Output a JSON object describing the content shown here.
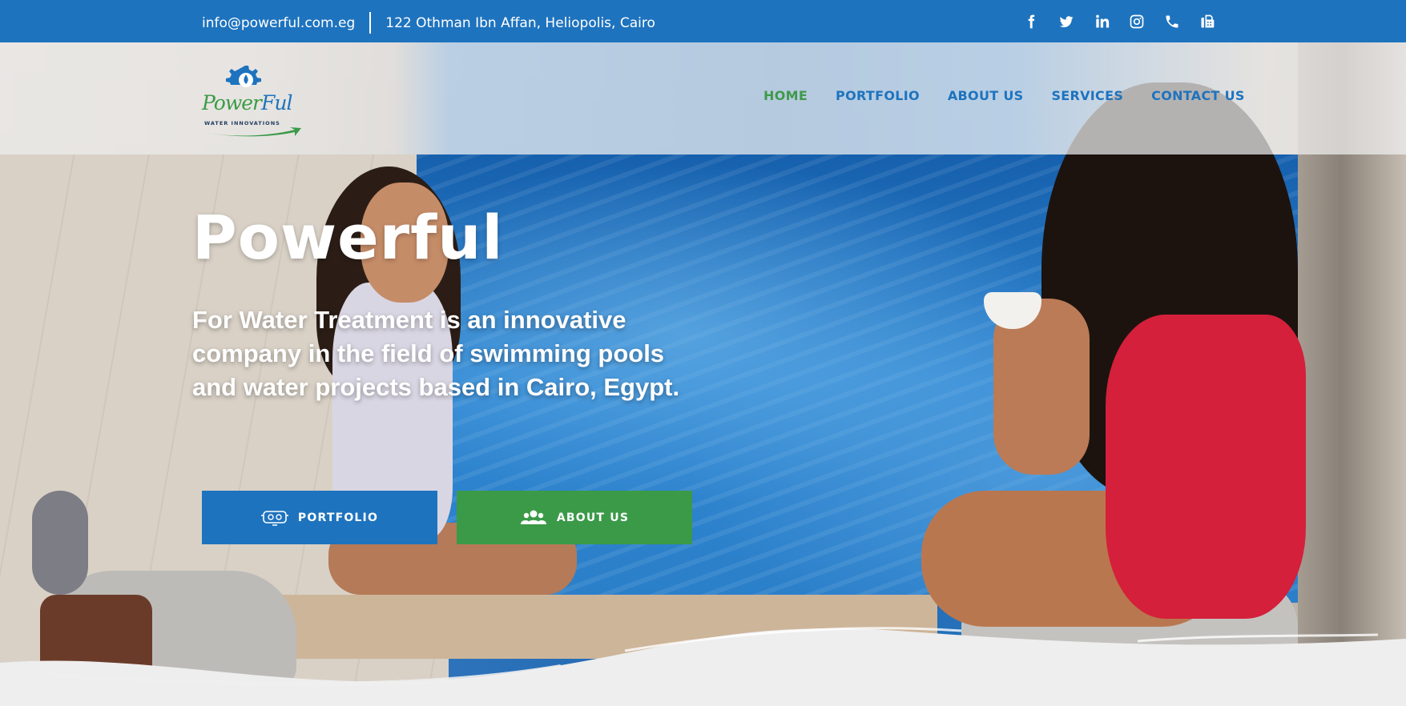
{
  "topbar": {
    "email": "info@powerful.com.eg",
    "address": "122 Othman Ibn Affan, Heliopolis, Cairo",
    "socials": [
      "facebook-icon",
      "twitter-icon",
      "linkedin-icon",
      "instagram-icon",
      "phone-icon",
      "fax-icon"
    ]
  },
  "logo": {
    "brand_part1": "Power",
    "brand_part2": "Ful",
    "tagline": "WATER INNOVATIONS"
  },
  "nav": {
    "items": [
      {
        "label": "HOME",
        "active": true
      },
      {
        "label": "PORTFOLIO",
        "active": false
      },
      {
        "label": "ABOUT US",
        "active": false
      },
      {
        "label": "SERVICES",
        "active": false
      },
      {
        "label": "CONTACT US",
        "active": false
      }
    ]
  },
  "hero": {
    "title": "Powerful",
    "subtitle": "For Water Treatment is an innovative company in the field of swimming pools and water projects based in Cairo, Egypt.",
    "buttons": {
      "portfolio": "PORTFOLIO",
      "about": "ABOUT US"
    }
  },
  "colors": {
    "primary_blue": "#1e73be",
    "accent_green": "#3a9a48"
  }
}
